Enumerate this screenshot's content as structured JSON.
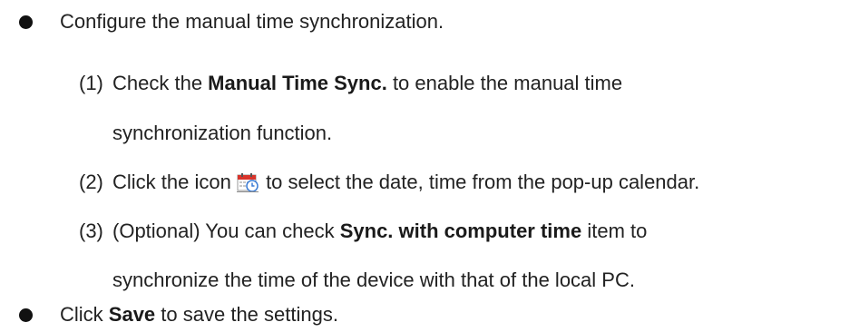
{
  "bullets": [
    {
      "text": "Configure the manual time synchronization."
    },
    {
      "pre": "Click ",
      "bold": "Save",
      "post": " to save the settings."
    }
  ],
  "steps": [
    {
      "num": "(1)",
      "pre": "Check the ",
      "bold": "Manual Time Sync.",
      "post": " to enable the manual time",
      "cont": "synchronization function."
    },
    {
      "num": "(2)",
      "pre": "Click the icon ",
      "post": " to select the date, time from the pop-up calendar.",
      "icon": "calendar-clock-icon"
    },
    {
      "num": "(3)",
      "pre": "(Optional) You can check ",
      "bold": "Sync. with computer time",
      "post": " item to",
      "cont": "synchronize the time of the device with that of the local PC."
    }
  ],
  "colors": {
    "text": "#222222",
    "icon_red": "#d9342b",
    "icon_clock": "#3a7bd5"
  }
}
